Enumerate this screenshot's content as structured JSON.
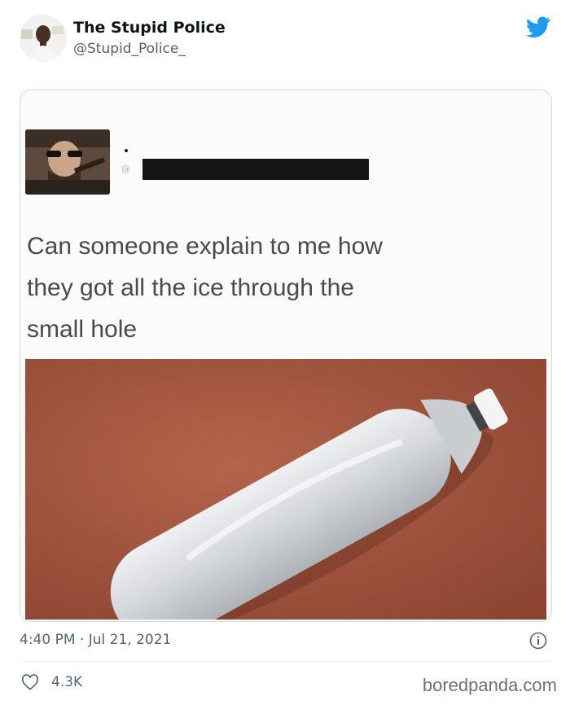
{
  "tweet": {
    "author_name": "The Stupid Police",
    "author_handle": "@Stupid_Police_",
    "timestamp": "4:40 PM · Jul 21, 2021",
    "likes": "4.3K"
  },
  "embedded_post": {
    "text_lines": [
      "Can someone explain to me how",
      "they got all the ice through the",
      "small hole"
    ]
  },
  "watermark": "boredpanda.com",
  "colors": {
    "twitter_blue": "#1d9bf0",
    "secondary_text": "#536471",
    "photo_surface": "#a8563f"
  }
}
